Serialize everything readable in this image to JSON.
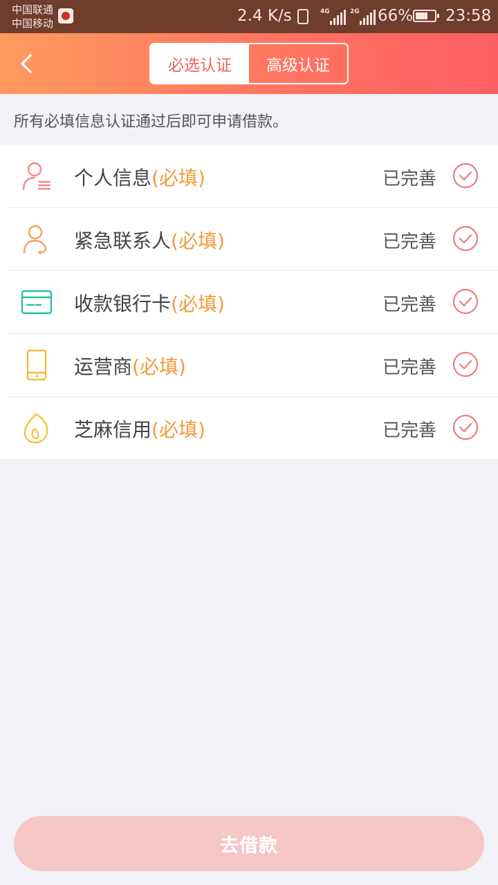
{
  "status_bar": {
    "carrier_1": "中国联通",
    "carrier_2": "中国移动",
    "net_speed": "2.4 K/s",
    "signal_1_label": "4G",
    "signal_2_label": "2G",
    "battery": "66%",
    "battery_level": 0.66,
    "time": "23:58"
  },
  "header": {
    "tabs": [
      {
        "label": "必选认证",
        "active": true
      },
      {
        "label": "高级认证",
        "active": false
      }
    ]
  },
  "notice": "所有必填信息认证通过后即可申请借款。",
  "items": [
    {
      "title": "个人信息",
      "required": "(必填)",
      "status": "已完善",
      "icon": "person-icon",
      "color": "#f08a8a"
    },
    {
      "title": "紧急联系人",
      "required": "(必填)",
      "status": "已完善",
      "icon": "contact-icon",
      "color": "#f3a35a"
    },
    {
      "title": "收款银行卡",
      "required": "(必填)",
      "status": "已完善",
      "icon": "bank-card-icon",
      "color": "#26c1a8"
    },
    {
      "title": "运营商",
      "required": "(必填)",
      "status": "已完善",
      "icon": "phone-icon",
      "color": "#f5b93a"
    },
    {
      "title": "芝麻信用",
      "required": "(必填)",
      "status": "已完善",
      "icon": "sesame-icon",
      "color": "#f5c23a"
    }
  ],
  "colors": {
    "accent": "#ff6f61",
    "required": "#f39a3a",
    "check": "#ee7b7b",
    "button": "#f5c7c4"
  },
  "loan_button": "去借款"
}
